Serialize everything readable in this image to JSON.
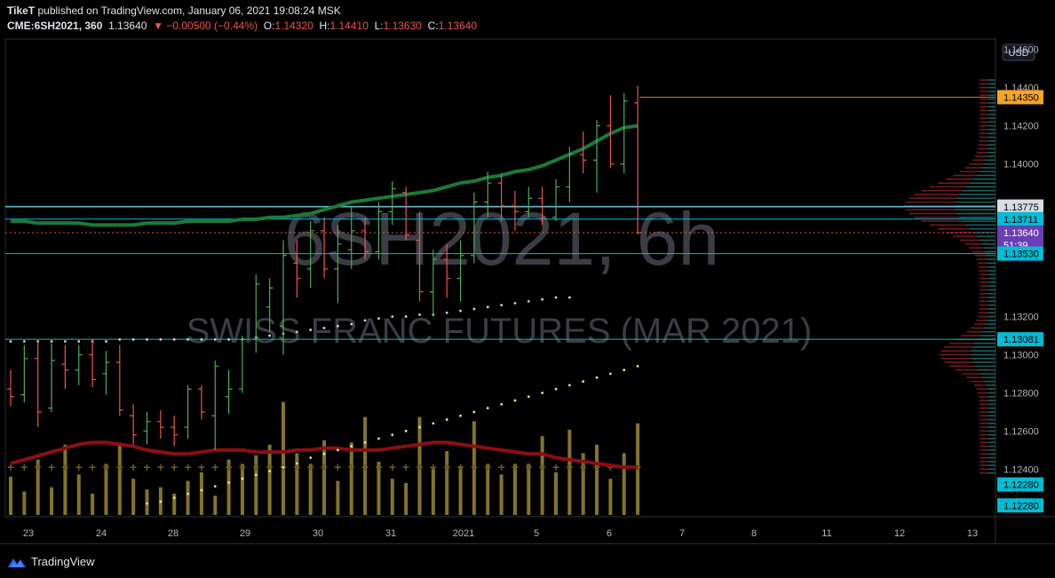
{
  "header": {
    "author": "TikeT",
    "published_text": "published on TradingView.com, January 06, 2021 19:08:24 MSK",
    "symbol": "CME:6SH2021, 360",
    "last": "1.13640",
    "change": "▼ −0.00500 (−0.44%)",
    "o_label": "O:",
    "o": "1.14320",
    "h_label": "H:",
    "h": "1.14410",
    "l_label": "L:",
    "l": "1.13630",
    "c_label": "C:",
    "c": "1.13640"
  },
  "watermark": {
    "line1": "6SH2021, 6h",
    "line2": "SWISS FRANC FUTURES (MAR 2021)"
  },
  "currency_button": "USD",
  "price_axis": {
    "ticks": [
      "1.14600",
      "1.14400",
      "1.14200",
      "1.14000",
      "1.13200",
      "1.13000",
      "1.12800",
      "1.12600",
      "1.12400"
    ],
    "badges": [
      {
        "text": "1.14350",
        "bg": "#f5a623",
        "fg": "#000000",
        "price": 1.1435
      },
      {
        "text": "1.13778",
        "bg": "#00bcd4",
        "fg": "#000000",
        "price": 1.13778
      },
      {
        "text": "1.13775",
        "bg": "#d6dde6",
        "fg": "#000000",
        "price": 1.13775
      },
      {
        "text": "1.13711",
        "bg": "#00bcd4",
        "fg": "#000000",
        "price": 1.13711
      },
      {
        "text": "1.13640",
        "bg": "#6a3fb5",
        "fg": "#ffffff",
        "price": 1.1364
      },
      {
        "text": "51:39",
        "bg": "#6a3fb5",
        "fg": "#ffffff",
        "price": 1.13575
      },
      {
        "text": "1.13530",
        "bg": "#00bcd4",
        "fg": "#000000",
        "price": 1.1353
      },
      {
        "text": "1.13081",
        "bg": "#00bcd4",
        "fg": "#000000",
        "price": 1.13081
      },
      {
        "text": "1.12280",
        "bg": "#00bcd4",
        "fg": "#000000",
        "price": 1.1232
      },
      {
        "text": "1.12280",
        "bg": "#00bcd4",
        "fg": "#000000",
        "price": 1.1221
      }
    ]
  },
  "time_axis": {
    "labels": [
      "23",
      "24",
      "28",
      "29",
      "30",
      "31",
      "2021",
      "5",
      "6",
      "7",
      "8",
      "11",
      "12",
      "13"
    ]
  },
  "colors": {
    "up": "#4caf50",
    "down": "#ef5350",
    "ema_green": "#1b7a3a",
    "ema_red": "#8b0f12",
    "level_line": "#00bcd4",
    "last_price": "#ef5350",
    "volume": "#8a7a2a"
  },
  "chart_data": {
    "type": "bar",
    "title": "6SH2021, 6h",
    "subtitle": "SWISS FRANC FUTURES (MAR 2021)",
    "xlabel": "",
    "ylabel": "",
    "ylim": [
      1.1216,
      1.1465
    ],
    "horizontal_levels": [
      1.1435,
      1.13778,
      1.13775,
      1.13711,
      1.1364,
      1.1353,
      1.13081
    ],
    "ohlc": [
      {
        "o": 1.1282,
        "h": 1.1292,
        "l": 1.1273,
        "c": 1.1278
      },
      {
        "o": 1.1279,
        "h": 1.1305,
        "l": 1.1275,
        "c": 1.1298
      },
      {
        "o": 1.1298,
        "h": 1.1307,
        "l": 1.1262,
        "c": 1.127
      },
      {
        "o": 1.1272,
        "h": 1.1306,
        "l": 1.127,
        "c": 1.1297
      },
      {
        "o": 1.1295,
        "h": 1.1305,
        "l": 1.1282,
        "c": 1.1292
      },
      {
        "o": 1.1292,
        "h": 1.1305,
        "l": 1.1284,
        "c": 1.13
      },
      {
        "o": 1.13,
        "h": 1.1308,
        "l": 1.1283,
        "c": 1.1287
      },
      {
        "o": 1.129,
        "h": 1.1302,
        "l": 1.1279,
        "c": 1.1296
      },
      {
        "o": 1.1296,
        "h": 1.1305,
        "l": 1.1268,
        "c": 1.1271
      },
      {
        "o": 1.1268,
        "h": 1.1274,
        "l": 1.1253,
        "c": 1.1258
      },
      {
        "o": 1.126,
        "h": 1.127,
        "l": 1.1253,
        "c": 1.1265
      },
      {
        "o": 1.1265,
        "h": 1.1271,
        "l": 1.1256,
        "c": 1.1262
      },
      {
        "o": 1.1262,
        "h": 1.1268,
        "l": 1.1252,
        "c": 1.1258
      },
      {
        "o": 1.1262,
        "h": 1.1284,
        "l": 1.1256,
        "c": 1.1282
      },
      {
        "o": 1.1282,
        "h": 1.1284,
        "l": 1.1266,
        "c": 1.127
      },
      {
        "o": 1.1268,
        "h": 1.1297,
        "l": 1.125,
        "c": 1.1294
      },
      {
        "o": 1.1278,
        "h": 1.1292,
        "l": 1.1269,
        "c": 1.1282
      },
      {
        "o": 1.1282,
        "h": 1.131,
        "l": 1.128,
        "c": 1.1308
      },
      {
        "o": 1.1308,
        "h": 1.1342,
        "l": 1.1301,
        "c": 1.1337
      },
      {
        "o": 1.1325,
        "h": 1.134,
        "l": 1.1312,
        "c": 1.1335
      },
      {
        "o": 1.1315,
        "h": 1.136,
        "l": 1.13,
        "c": 1.1352
      },
      {
        "o": 1.1348,
        "h": 1.136,
        "l": 1.133,
        "c": 1.134
      },
      {
        "o": 1.1345,
        "h": 1.137,
        "l": 1.1335,
        "c": 1.1365
      },
      {
        "o": 1.1365,
        "h": 1.1372,
        "l": 1.134,
        "c": 1.1345
      },
      {
        "o": 1.1345,
        "h": 1.1368,
        "l": 1.1327,
        "c": 1.1358
      },
      {
        "o": 1.1355,
        "h": 1.1378,
        "l": 1.1345,
        "c": 1.1365
      },
      {
        "o": 1.1365,
        "h": 1.1372,
        "l": 1.135,
        "c": 1.1354
      },
      {
        "o": 1.1354,
        "h": 1.138,
        "l": 1.135,
        "c": 1.1375
      },
      {
        "o": 1.1375,
        "h": 1.1391,
        "l": 1.1368,
        "c": 1.1387
      },
      {
        "o": 1.1385,
        "h": 1.1388,
        "l": 1.136,
        "c": 1.1363
      },
      {
        "o": 1.136,
        "h": 1.1375,
        "l": 1.1328,
        "c": 1.1333
      },
      {
        "o": 1.1333,
        "h": 1.1355,
        "l": 1.132,
        "c": 1.135
      },
      {
        "o": 1.135,
        "h": 1.1358,
        "l": 1.133,
        "c": 1.134
      },
      {
        "o": 1.134,
        "h": 1.136,
        "l": 1.1328,
        "c": 1.1352
      },
      {
        "o": 1.1352,
        "h": 1.1385,
        "l": 1.1348,
        "c": 1.138
      },
      {
        "o": 1.138,
        "h": 1.1396,
        "l": 1.1372,
        "c": 1.139
      },
      {
        "o": 1.139,
        "h": 1.1395,
        "l": 1.137,
        "c": 1.1378
      },
      {
        "o": 1.1378,
        "h": 1.1386,
        "l": 1.1365,
        "c": 1.1375
      },
      {
        "o": 1.1375,
        "h": 1.1388,
        "l": 1.1372,
        "c": 1.1382
      },
      {
        "o": 1.1382,
        "h": 1.1388,
        "l": 1.1368,
        "c": 1.1372
      },
      {
        "o": 1.1372,
        "h": 1.1392,
        "l": 1.137,
        "c": 1.1388
      },
      {
        "o": 1.1388,
        "h": 1.1409,
        "l": 1.138,
        "c": 1.1405
      },
      {
        "o": 1.1405,
        "h": 1.1417,
        "l": 1.1395,
        "c": 1.1402
      },
      {
        "o": 1.1402,
        "h": 1.1423,
        "l": 1.1385,
        "c": 1.142
      },
      {
        "o": 1.142,
        "h": 1.1436,
        "l": 1.1398,
        "c": 1.14
      },
      {
        "o": 1.14,
        "h": 1.1437,
        "l": 1.1395,
        "c": 1.1433
      },
      {
        "o": 1.1432,
        "h": 1.1441,
        "l": 1.1363,
        "c": 1.1364
      }
    ],
    "volume": [
      1.8,
      1.1,
      2.6,
      1.3,
      3.3,
      1.9,
      1.0,
      2.4,
      3.4,
      1.7,
      1.2,
      1.3,
      1.0,
      1.6,
      2.0,
      0.9,
      2.6,
      2.4,
      2.8,
      3.3,
      5.3,
      2.9,
      2.4,
      3.5,
      1.6,
      3.4,
      4.6,
      2.5,
      1.7,
      1.5,
      4.6,
      2.2,
      3.0,
      2.3,
      4.4,
      2.4,
      1.9,
      2.4,
      2.4,
      3.7,
      2.0,
      4.0,
      2.9,
      3.3,
      1.7,
      2.9,
      4.3
    ],
    "ema_green": [
      1.137,
      1.137,
      1.1369,
      1.1369,
      1.1369,
      1.1369,
      1.1368,
      1.1368,
      1.1368,
      1.1368,
      1.1369,
      1.1369,
      1.1369,
      1.137,
      1.137,
      1.137,
      1.137,
      1.1371,
      1.1371,
      1.1372,
      1.1372,
      1.1373,
      1.1374,
      1.1376,
      1.1378,
      1.138,
      1.1381,
      1.1382,
      1.1383,
      1.1384,
      1.1385,
      1.1386,
      1.1388,
      1.139,
      1.1391,
      1.1393,
      1.1394,
      1.1396,
      1.1397,
      1.1399,
      1.1402,
      1.1405,
      1.1408,
      1.1412,
      1.1416,
      1.1419,
      1.142
    ],
    "ema_red": [
      1.1243,
      1.1245,
      1.1247,
      1.1249,
      1.1251,
      1.1253,
      1.1254,
      1.1254,
      1.1253,
      1.1252,
      1.125,
      1.1249,
      1.1248,
      1.1248,
      1.1249,
      1.125,
      1.125,
      1.125,
      1.1249,
      1.1249,
      1.1249,
      1.125,
      1.125,
      1.1251,
      1.1251,
      1.125,
      1.125,
      1.125,
      1.1251,
      1.1252,
      1.1253,
      1.1254,
      1.1254,
      1.1253,
      1.1252,
      1.1251,
      1.125,
      1.1249,
      1.1248,
      1.1248,
      1.1246,
      1.1245,
      1.1244,
      1.1243,
      1.1242,
      1.1241,
      1.1241
    ],
    "dots_upper": [
      1.1307,
      1.1307,
      1.1307,
      1.1307,
      1.1307,
      1.1307,
      1.1307,
      1.1307,
      1.1308,
      1.1308,
      1.1308,
      1.1308,
      1.1308,
      1.1308,
      1.1308,
      1.1308,
      1.1308,
      1.1308,
      1.1309,
      1.131,
      1.1311,
      1.1312,
      1.1313,
      1.1314,
      1.1315,
      1.1316,
      1.1318,
      1.1319,
      1.132,
      1.132,
      1.1321,
      1.1321,
      1.1322,
      1.1323,
      1.1324,
      1.1325,
      1.1326,
      1.1327,
      1.1328,
      1.1329,
      1.133,
      1.133
    ],
    "dots_lower": [
      1.1222,
      1.1223,
      1.1225,
      1.1227,
      1.1229,
      1.1231,
      1.1233,
      1.1235,
      1.1237,
      1.1239,
      1.1241,
      1.1243,
      1.1246,
      1.1248,
      1.125,
      1.1252,
      1.1254,
      1.1256,
      1.1258,
      1.126,
      1.1262,
      1.1264,
      1.1266,
      1.1268,
      1.127,
      1.1272,
      1.1274,
      1.1276,
      1.1278,
      1.128,
      1.1282,
      1.1284,
      1.1286,
      1.1288,
      1.129,
      1.1292,
      1.1294
    ]
  },
  "footer": {
    "brand": "TradingView"
  }
}
